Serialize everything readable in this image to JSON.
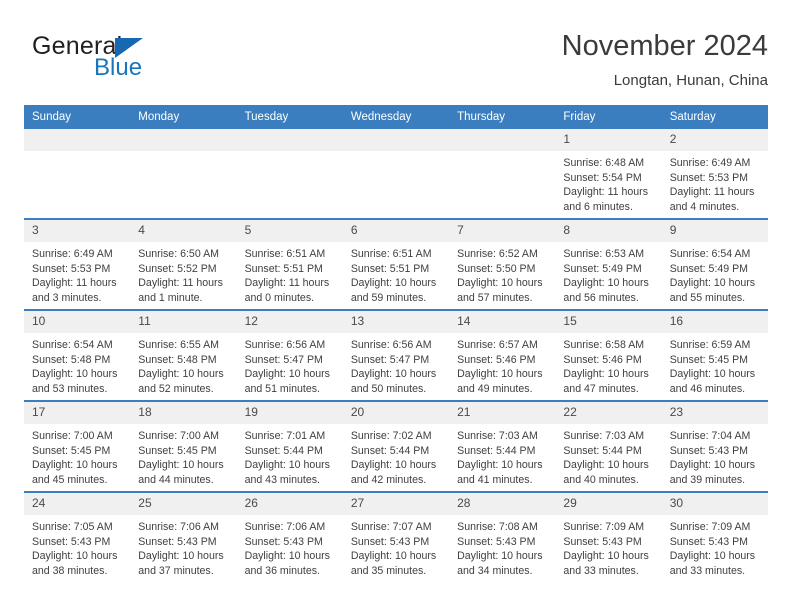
{
  "logo": {
    "word_one": "General",
    "word_two": "Blue",
    "triangle_color": "#1668b3",
    "word_two_color": "#1b75bb"
  },
  "header": {
    "title": "November 2024",
    "subtitle": "Longtan, Hunan, China"
  },
  "theme": {
    "header_bg": "#3a7ebf",
    "header_text": "#ffffff",
    "daynum_bg": "#f0f0f0",
    "row_divider": "#3a7ebf",
    "body_text": "#3f3f3f"
  },
  "weekday_headers": [
    "Sunday",
    "Monday",
    "Tuesday",
    "Wednesday",
    "Thursday",
    "Friday",
    "Saturday"
  ],
  "labels": {
    "sunrise": "Sunrise:",
    "sunset": "Sunset:",
    "daylight": "Daylight:"
  },
  "weeks": [
    [
      {
        "day": "",
        "empty": true
      },
      {
        "day": "",
        "empty": true
      },
      {
        "day": "",
        "empty": true
      },
      {
        "day": "",
        "empty": true
      },
      {
        "day": "",
        "empty": true
      },
      {
        "day": "1",
        "sunrise": "Sunrise: 6:48 AM",
        "sunset": "Sunset: 5:54 PM",
        "daylight": "Daylight: 11 hours and 6 minutes."
      },
      {
        "day": "2",
        "sunrise": "Sunrise: 6:49 AM",
        "sunset": "Sunset: 5:53 PM",
        "daylight": "Daylight: 11 hours and 4 minutes."
      }
    ],
    [
      {
        "day": "3",
        "sunrise": "Sunrise: 6:49 AM",
        "sunset": "Sunset: 5:53 PM",
        "daylight": "Daylight: 11 hours and 3 minutes."
      },
      {
        "day": "4",
        "sunrise": "Sunrise: 6:50 AM",
        "sunset": "Sunset: 5:52 PM",
        "daylight": "Daylight: 11 hours and 1 minute."
      },
      {
        "day": "5",
        "sunrise": "Sunrise: 6:51 AM",
        "sunset": "Sunset: 5:51 PM",
        "daylight": "Daylight: 11 hours and 0 minutes."
      },
      {
        "day": "6",
        "sunrise": "Sunrise: 6:51 AM",
        "sunset": "Sunset: 5:51 PM",
        "daylight": "Daylight: 10 hours and 59 minutes."
      },
      {
        "day": "7",
        "sunrise": "Sunrise: 6:52 AM",
        "sunset": "Sunset: 5:50 PM",
        "daylight": "Daylight: 10 hours and 57 minutes."
      },
      {
        "day": "8",
        "sunrise": "Sunrise: 6:53 AM",
        "sunset": "Sunset: 5:49 PM",
        "daylight": "Daylight: 10 hours and 56 minutes."
      },
      {
        "day": "9",
        "sunrise": "Sunrise: 6:54 AM",
        "sunset": "Sunset: 5:49 PM",
        "daylight": "Daylight: 10 hours and 55 minutes."
      }
    ],
    [
      {
        "day": "10",
        "sunrise": "Sunrise: 6:54 AM",
        "sunset": "Sunset: 5:48 PM",
        "daylight": "Daylight: 10 hours and 53 minutes."
      },
      {
        "day": "11",
        "sunrise": "Sunrise: 6:55 AM",
        "sunset": "Sunset: 5:48 PM",
        "daylight": "Daylight: 10 hours and 52 minutes."
      },
      {
        "day": "12",
        "sunrise": "Sunrise: 6:56 AM",
        "sunset": "Sunset: 5:47 PM",
        "daylight": "Daylight: 10 hours and 51 minutes."
      },
      {
        "day": "13",
        "sunrise": "Sunrise: 6:56 AM",
        "sunset": "Sunset: 5:47 PM",
        "daylight": "Daylight: 10 hours and 50 minutes."
      },
      {
        "day": "14",
        "sunrise": "Sunrise: 6:57 AM",
        "sunset": "Sunset: 5:46 PM",
        "daylight": "Daylight: 10 hours and 49 minutes."
      },
      {
        "day": "15",
        "sunrise": "Sunrise: 6:58 AM",
        "sunset": "Sunset: 5:46 PM",
        "daylight": "Daylight: 10 hours and 47 minutes."
      },
      {
        "day": "16",
        "sunrise": "Sunrise: 6:59 AM",
        "sunset": "Sunset: 5:45 PM",
        "daylight": "Daylight: 10 hours and 46 minutes."
      }
    ],
    [
      {
        "day": "17",
        "sunrise": "Sunrise: 7:00 AM",
        "sunset": "Sunset: 5:45 PM",
        "daylight": "Daylight: 10 hours and 45 minutes."
      },
      {
        "day": "18",
        "sunrise": "Sunrise: 7:00 AM",
        "sunset": "Sunset: 5:45 PM",
        "daylight": "Daylight: 10 hours and 44 minutes."
      },
      {
        "day": "19",
        "sunrise": "Sunrise: 7:01 AM",
        "sunset": "Sunset: 5:44 PM",
        "daylight": "Daylight: 10 hours and 43 minutes."
      },
      {
        "day": "20",
        "sunrise": "Sunrise: 7:02 AM",
        "sunset": "Sunset: 5:44 PM",
        "daylight": "Daylight: 10 hours and 42 minutes."
      },
      {
        "day": "21",
        "sunrise": "Sunrise: 7:03 AM",
        "sunset": "Sunset: 5:44 PM",
        "daylight": "Daylight: 10 hours and 41 minutes."
      },
      {
        "day": "22",
        "sunrise": "Sunrise: 7:03 AM",
        "sunset": "Sunset: 5:44 PM",
        "daylight": "Daylight: 10 hours and 40 minutes."
      },
      {
        "day": "23",
        "sunrise": "Sunrise: 7:04 AM",
        "sunset": "Sunset: 5:43 PM",
        "daylight": "Daylight: 10 hours and 39 minutes."
      }
    ],
    [
      {
        "day": "24",
        "sunrise": "Sunrise: 7:05 AM",
        "sunset": "Sunset: 5:43 PM",
        "daylight": "Daylight: 10 hours and 38 minutes."
      },
      {
        "day": "25",
        "sunrise": "Sunrise: 7:06 AM",
        "sunset": "Sunset: 5:43 PM",
        "daylight": "Daylight: 10 hours and 37 minutes."
      },
      {
        "day": "26",
        "sunrise": "Sunrise: 7:06 AM",
        "sunset": "Sunset: 5:43 PM",
        "daylight": "Daylight: 10 hours and 36 minutes."
      },
      {
        "day": "27",
        "sunrise": "Sunrise: 7:07 AM",
        "sunset": "Sunset: 5:43 PM",
        "daylight": "Daylight: 10 hours and 35 minutes."
      },
      {
        "day": "28",
        "sunrise": "Sunrise: 7:08 AM",
        "sunset": "Sunset: 5:43 PM",
        "daylight": "Daylight: 10 hours and 34 minutes."
      },
      {
        "day": "29",
        "sunrise": "Sunrise: 7:09 AM",
        "sunset": "Sunset: 5:43 PM",
        "daylight": "Daylight: 10 hours and 33 minutes."
      },
      {
        "day": "30",
        "sunrise": "Sunrise: 7:09 AM",
        "sunset": "Sunset: 5:43 PM",
        "daylight": "Daylight: 10 hours and 33 minutes."
      }
    ]
  ]
}
